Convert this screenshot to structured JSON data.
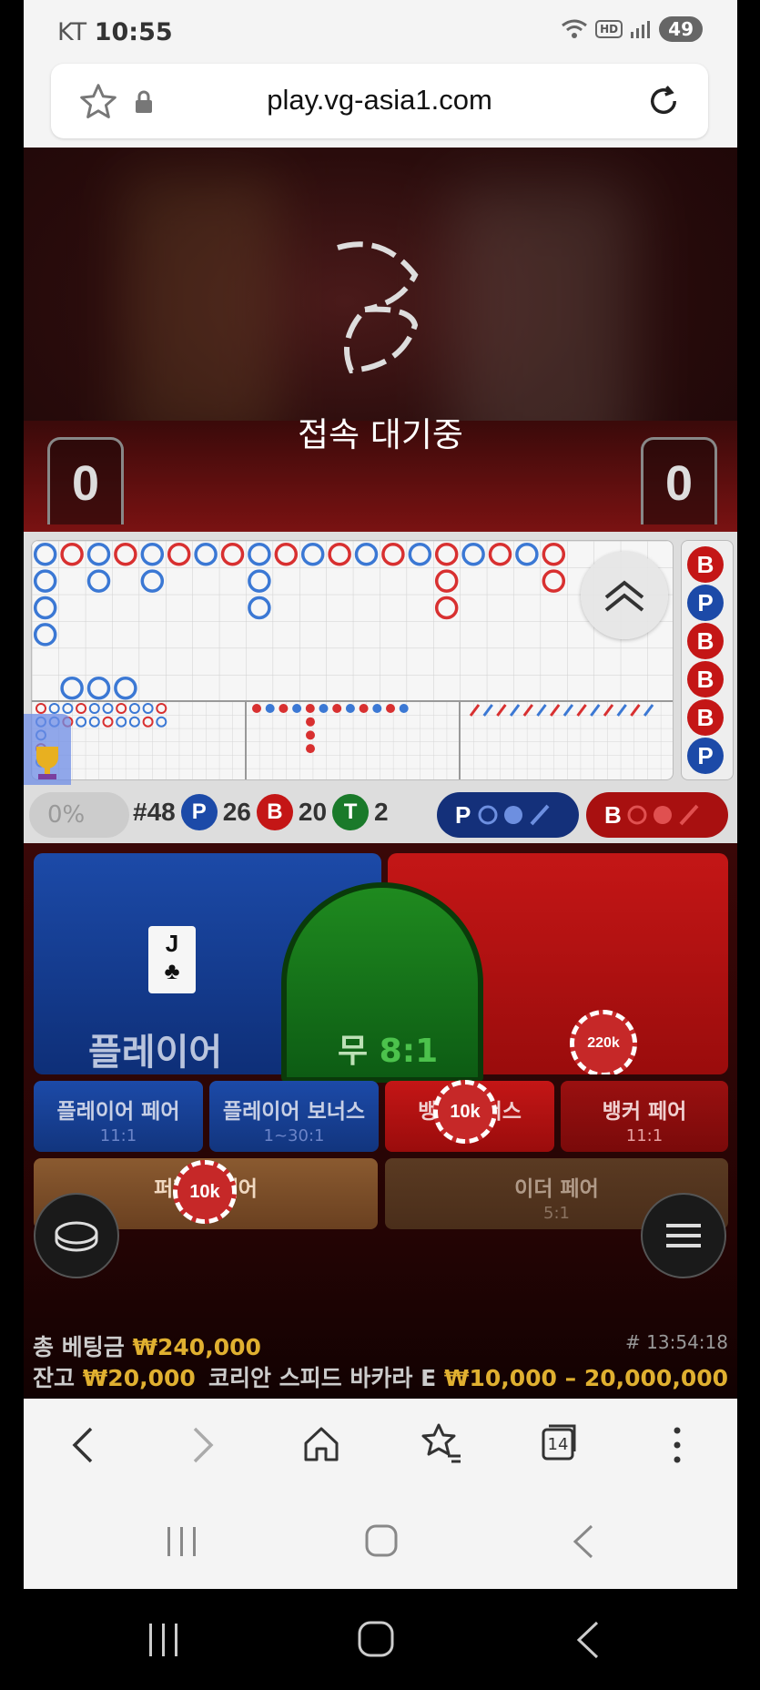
{
  "status_bar": {
    "carrier": "KT",
    "time": "10:55",
    "battery": "49"
  },
  "browser": {
    "url": "play.vg-asia1.com",
    "tabs_count": "14"
  },
  "video": {
    "status_text": "접속 대기중",
    "player_score": "0",
    "banker_score": "0"
  },
  "roadmap": {
    "progress": "0%",
    "round": "#48",
    "player_label": "P",
    "player_count": "26",
    "banker_label": "B",
    "banker_count": "20",
    "tie_label": "T",
    "tie_count": "2",
    "predict_player": "P",
    "predict_banker": "B",
    "previous_results": [
      "B",
      "P",
      "B",
      "B",
      "B",
      "P"
    ]
  },
  "betting": {
    "player_label": "플레이어",
    "tie_label": "무",
    "tie_odds": "8:1",
    "player_card_rank": "J",
    "player_card_suit": "♣",
    "banker_chip": "220k",
    "player_pair_label": "플레이어 페어",
    "player_pair_odds": "11:1",
    "player_bonus_label": "플레이어 보너스",
    "player_bonus_odds": "1~30:1",
    "banker_bonus_label": "뱅커 보너스",
    "banker_bonus_chip": "10k",
    "banker_pair_label": "뱅커 페어",
    "banker_pair_odds": "11:1",
    "perfect_pair_label": "퍼펙트 페어",
    "perfect_pair_chip": "10k",
    "either_pair_label": "이더 페어",
    "either_pair_odds": "5:1"
  },
  "footer": {
    "total_bet_label": "총 베팅금",
    "total_bet_value": "₩240,000",
    "balance_label": "잔고",
    "balance_value": "₩20,000",
    "game_id": "# 13:54:18",
    "table_name": "코리안 스피드 바카라 E",
    "table_limits": "₩10,000 – 20,000,000"
  },
  "colors": {
    "player": "#1c4aa8",
    "banker": "#c41616",
    "tie": "#1f8a1f",
    "gold": "#e0b030"
  }
}
